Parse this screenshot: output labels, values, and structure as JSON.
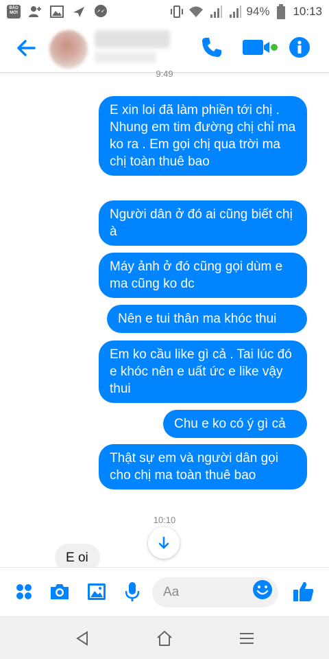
{
  "status_bar": {
    "battery": "94%",
    "time": "10:13",
    "app_badge": "BÁO MỚI"
  },
  "header": {
    "contact_name": "",
    "contact_status": ""
  },
  "conversation": {
    "timestamp_top": "9:49",
    "outgoing": [
      "E xin loi đã làm phiền tới chị . Nhung em tim đường chị chỉ ma ko ra . Em gọi chị qua trời ma chị toàn thuê bao",
      "Người dân ở đó ai cũng biết chị à",
      "Máy ảnh ở đó cũng gọi dùm e ma cũng ko dc",
      "Nên e tui thân ma khóc thui",
      "Em ko cầu like gì cả . Tai lúc đó e khóc nên e uất ức e like vậy thui",
      "Chu e ko có ý gì cả",
      "Thật sự em và người dân gọi cho chị ma toàn thuê bao"
    ],
    "timestamp_bottom": "10:10",
    "incoming": [
      "E oi"
    ]
  },
  "composer": {
    "placeholder": "Aa"
  },
  "colors": {
    "accent": "#0084ff",
    "incoming_bubble": "#f1f0f0"
  }
}
